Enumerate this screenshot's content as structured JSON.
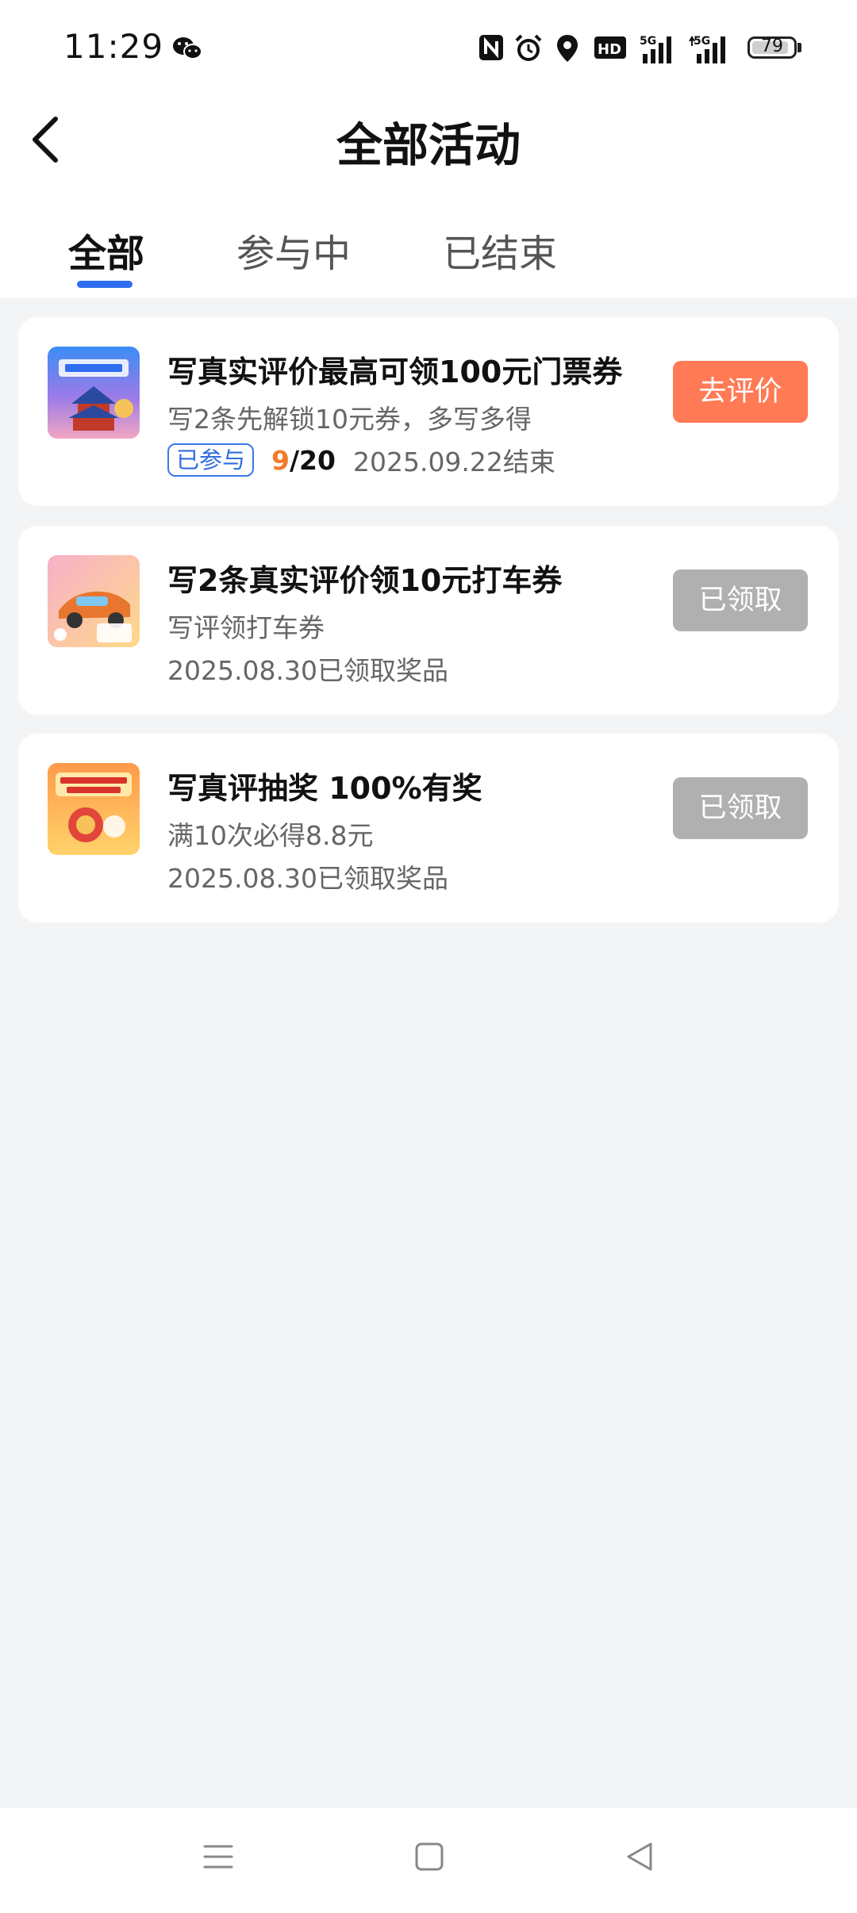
{
  "status_bar": {
    "time": "11:29",
    "battery": "79",
    "icons": [
      "wechat-icon",
      "nfc-icon",
      "alarm-icon",
      "location-icon",
      "hd-icon",
      "signal-5g-icon",
      "signal-5g-icon-2"
    ]
  },
  "header": {
    "title": "全部活动"
  },
  "tabs": [
    {
      "label": "全部",
      "active": true
    },
    {
      "label": "参与中",
      "active": false
    },
    {
      "label": "已结束",
      "active": false
    }
  ],
  "activities": [
    {
      "title": "写真实评价最高可领100元门票券",
      "subtitle": "写2条先解锁10元券，多写多得",
      "badge": "已参与",
      "progress_current": "9",
      "progress_total": "/20",
      "date": "2025.09.22结束",
      "button": "去评价",
      "button_color": "#ff7a55"
    },
    {
      "title": "写2条真实评价领10元打车券",
      "subtitle": "写评领打车券",
      "status": "2025.08.30已领取奖品",
      "button": "已领取",
      "button_color": "#b0b0b0"
    },
    {
      "title": "写真评抽奖 100%有奖",
      "subtitle": "满10次必得8.8元",
      "status": "2025.08.30已领取奖品",
      "button": "已领取",
      "button_color": "#b0b0b0"
    }
  ],
  "nav": {
    "icons": [
      "menu-icon",
      "home-icon",
      "back-triangle-icon"
    ]
  },
  "colors": {
    "accent": "#2f6df0",
    "orange": "#f07c2c",
    "background": "#f3f4f6"
  }
}
